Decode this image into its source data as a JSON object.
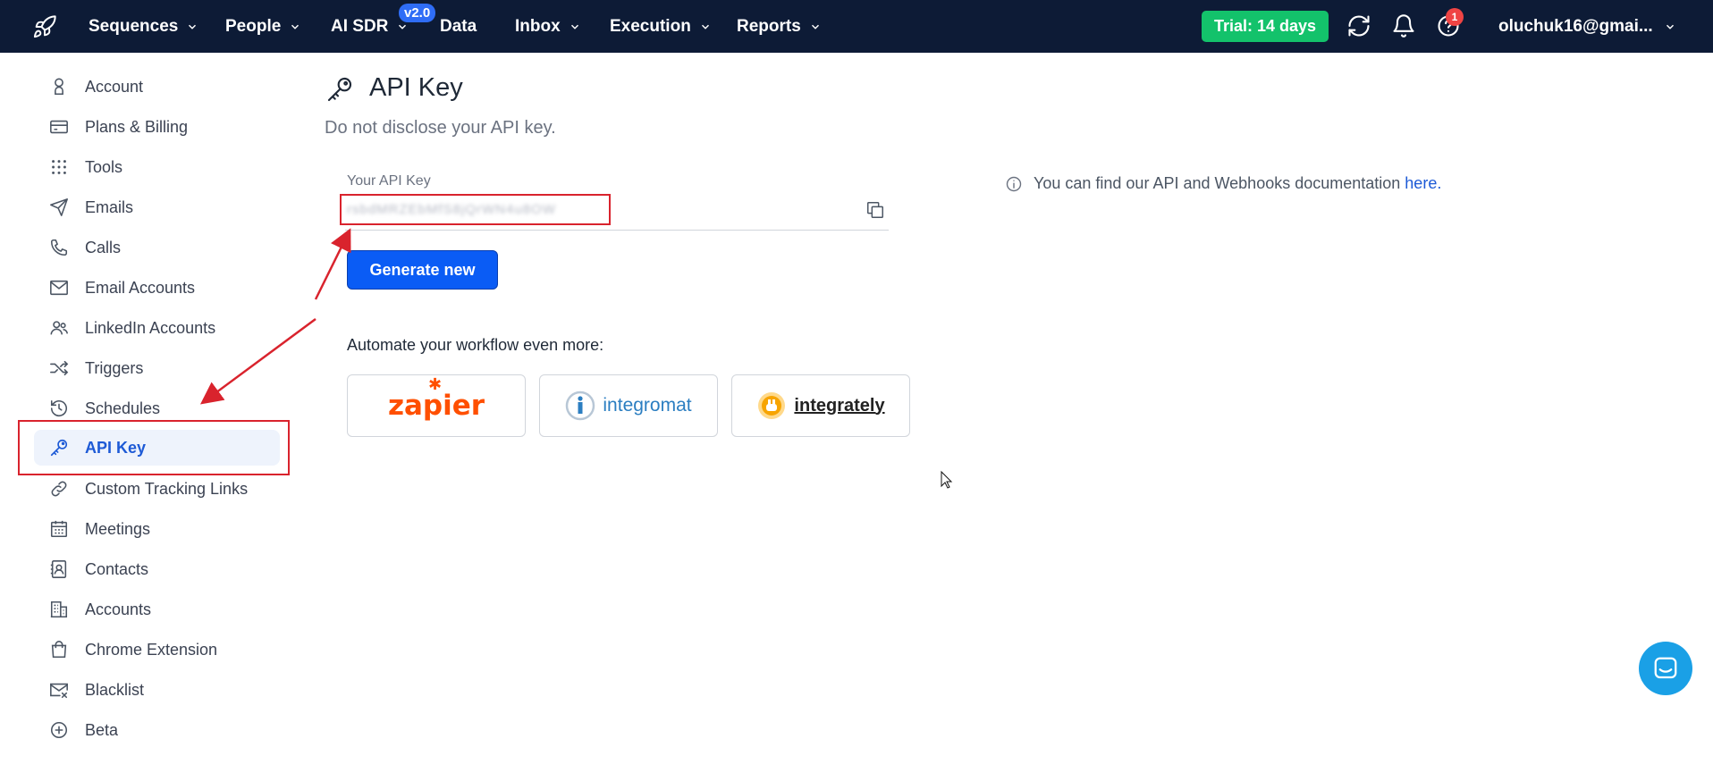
{
  "nav": {
    "items": [
      {
        "label": "Sequences",
        "has_chevron": true
      },
      {
        "label": "People",
        "has_chevron": true
      },
      {
        "label": "AI SDR",
        "has_chevron": true,
        "badge": "v2.0"
      },
      {
        "label": "Data",
        "has_chevron": false
      },
      {
        "label": "Inbox",
        "has_chevron": true
      },
      {
        "label": "Execution",
        "has_chevron": true
      },
      {
        "label": "Reports",
        "has_chevron": true
      }
    ],
    "trial_label": "Trial: 14 days",
    "notification_count": "1",
    "user_email": "oluchuk16@gmai..."
  },
  "sidebar": {
    "items": [
      {
        "label": "Account",
        "icon": "user-icon"
      },
      {
        "label": "Plans & Billing",
        "icon": "credit-card-icon"
      },
      {
        "label": "Tools",
        "icon": "grid-icon"
      },
      {
        "label": "Emails",
        "icon": "send-icon"
      },
      {
        "label": "Calls",
        "icon": "phone-icon"
      },
      {
        "label": "Email Accounts",
        "icon": "mail-icon"
      },
      {
        "label": "LinkedIn Accounts",
        "icon": "users-icon"
      },
      {
        "label": "Triggers",
        "icon": "shuffle-icon"
      },
      {
        "label": "Schedules",
        "icon": "history-icon"
      },
      {
        "label": "API Key",
        "icon": "key-icon",
        "active": true
      },
      {
        "label": "Custom Tracking Links",
        "icon": "link-icon"
      },
      {
        "label": "Meetings",
        "icon": "calendar-icon"
      },
      {
        "label": "Contacts",
        "icon": "contact-book-icon"
      },
      {
        "label": "Accounts",
        "icon": "building-icon"
      },
      {
        "label": "Chrome Extension",
        "icon": "shopping-bag-icon"
      },
      {
        "label": "Blacklist",
        "icon": "mail-x-icon"
      },
      {
        "label": "Beta",
        "icon": "plus-circle-icon"
      }
    ]
  },
  "main": {
    "title": "API Key",
    "subtitle": "Do not disclose your API key.",
    "key_label": "Your API Key",
    "key_value": "rsbdMRZEbMfS8jQrWN4u8OW",
    "generate_label": "Generate new",
    "automate_label": "Automate your workflow even more:",
    "integrations": [
      {
        "label": "zapier",
        "color": "#ff4f00"
      },
      {
        "label": "integromat",
        "color": "#2b7ec1"
      },
      {
        "label": "integrately",
        "color": "#222222"
      }
    ],
    "info_text": "You can find our API and Webhooks documentation",
    "info_link": "here."
  },
  "colors": {
    "topbar": "#0d1b36",
    "accent": "#0a5cf5",
    "trial": "#13c26b",
    "annotation": "#d9232d"
  }
}
